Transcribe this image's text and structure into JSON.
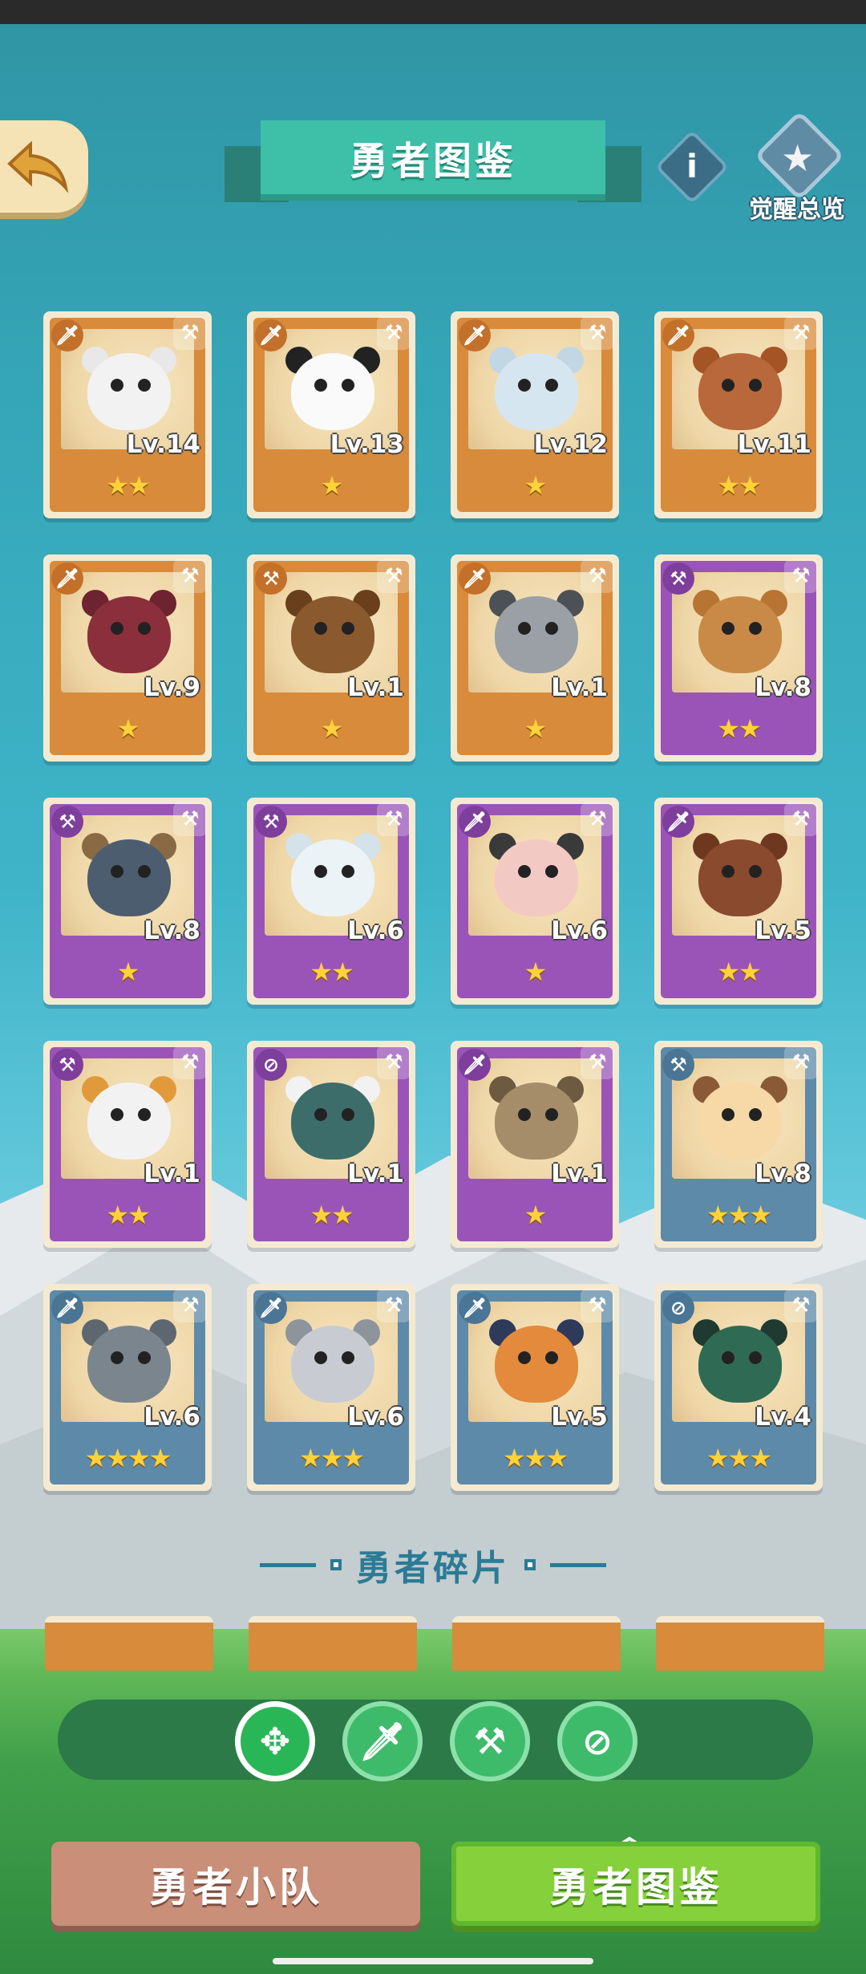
{
  "header": {
    "title": "勇者图鉴",
    "awaken_label": "觉醒总览"
  },
  "heroes": [
    {
      "level": "Lv.14",
      "stars": "★★",
      "rarity": "orange",
      "role": "sword",
      "head": "#f2f2f2",
      "ear": "#e8e8e8"
    },
    {
      "level": "Lv.13",
      "stars": "★",
      "rarity": "orange",
      "role": "sword",
      "head": "#fafafa",
      "ear": "#222222"
    },
    {
      "level": "Lv.12",
      "stars": "★",
      "rarity": "orange",
      "role": "sword",
      "head": "#d6e6f0",
      "ear": "#c3d6e4"
    },
    {
      "level": "Lv.11",
      "stars": "★★",
      "rarity": "orange",
      "role": "sword",
      "head": "#b8683a",
      "ear": "#a55426"
    },
    {
      "level": "Lv.9",
      "stars": "★",
      "rarity": "orange",
      "role": "sword",
      "head": "#8b2f3c",
      "ear": "#6e2330"
    },
    {
      "level": "Lv.1",
      "stars": "★",
      "rarity": "orange",
      "role": "hammer",
      "head": "#8a5a2e",
      "ear": "#6a401c"
    },
    {
      "level": "Lv.1",
      "stars": "★",
      "rarity": "orange",
      "role": "sword",
      "head": "#9aa0a6",
      "ear": "#4c5156"
    },
    {
      "level": "Lv.8",
      "stars": "★★",
      "rarity": "purple",
      "role": "hammer",
      "head": "#c98a48",
      "ear": "#b77432"
    },
    {
      "level": "Lv.8",
      "stars": "★",
      "rarity": "purple",
      "role": "hammer",
      "head": "#4d5d70",
      "ear": "#8a6a45"
    },
    {
      "level": "Lv.6",
      "stars": "★★",
      "rarity": "purple",
      "role": "hammer",
      "head": "#ecf3f6",
      "ear": "#d4e2ea"
    },
    {
      "level": "Lv.6",
      "stars": "★",
      "rarity": "purple",
      "role": "sword",
      "head": "#f3c9c4",
      "ear": "#3a3a3a"
    },
    {
      "level": "Lv.5",
      "stars": "★★",
      "rarity": "purple",
      "role": "sword",
      "head": "#8a4a2e",
      "ear": "#6e3720"
    },
    {
      "level": "Lv.1",
      "stars": "★★",
      "rarity": "purple",
      "role": "hammer",
      "head": "#f2f2f2",
      "ear": "#e19a3a"
    },
    {
      "level": "Lv.1",
      "stars": "★★",
      "rarity": "purple",
      "role": "compass",
      "head": "#3d6d6a",
      "ear": "#f2f2f2"
    },
    {
      "level": "Lv.1",
      "stars": "★",
      "rarity": "purple",
      "role": "sword",
      "head": "#a58d6a",
      "ear": "#6d5a40"
    },
    {
      "level": "Lv.8",
      "stars": "★★★",
      "rarity": "blue",
      "role": "hammer",
      "head": "#f6d9a6",
      "ear": "#8a5a36"
    },
    {
      "level": "Lv.6",
      "stars": "★★★★",
      "rarity": "blue",
      "role": "sword",
      "head": "#7b858e",
      "ear": "#5e6770"
    },
    {
      "level": "Lv.6",
      "stars": "★★★",
      "rarity": "blue",
      "role": "sword",
      "head": "#c8ccd2",
      "ear": "#8e949c"
    },
    {
      "level": "Lv.5",
      "stars": "★★★",
      "rarity": "blue",
      "role": "sword",
      "head": "#e38a3c",
      "ear": "#2e3a5a"
    },
    {
      "level": "Lv.4",
      "stars": "★★★",
      "rarity": "blue",
      "role": "compass",
      "head": "#2f6a55",
      "ear": "#1f3a30"
    }
  ],
  "section": {
    "shards_title": "勇者碎片"
  },
  "tabs": {
    "team": "勇者小队",
    "codex": "勇者图鉴"
  },
  "colors": {
    "orange": "#d88b3a",
    "purple": "#9a54b8",
    "blue": "#5d8aa9",
    "accent": "#3dbfa8"
  }
}
